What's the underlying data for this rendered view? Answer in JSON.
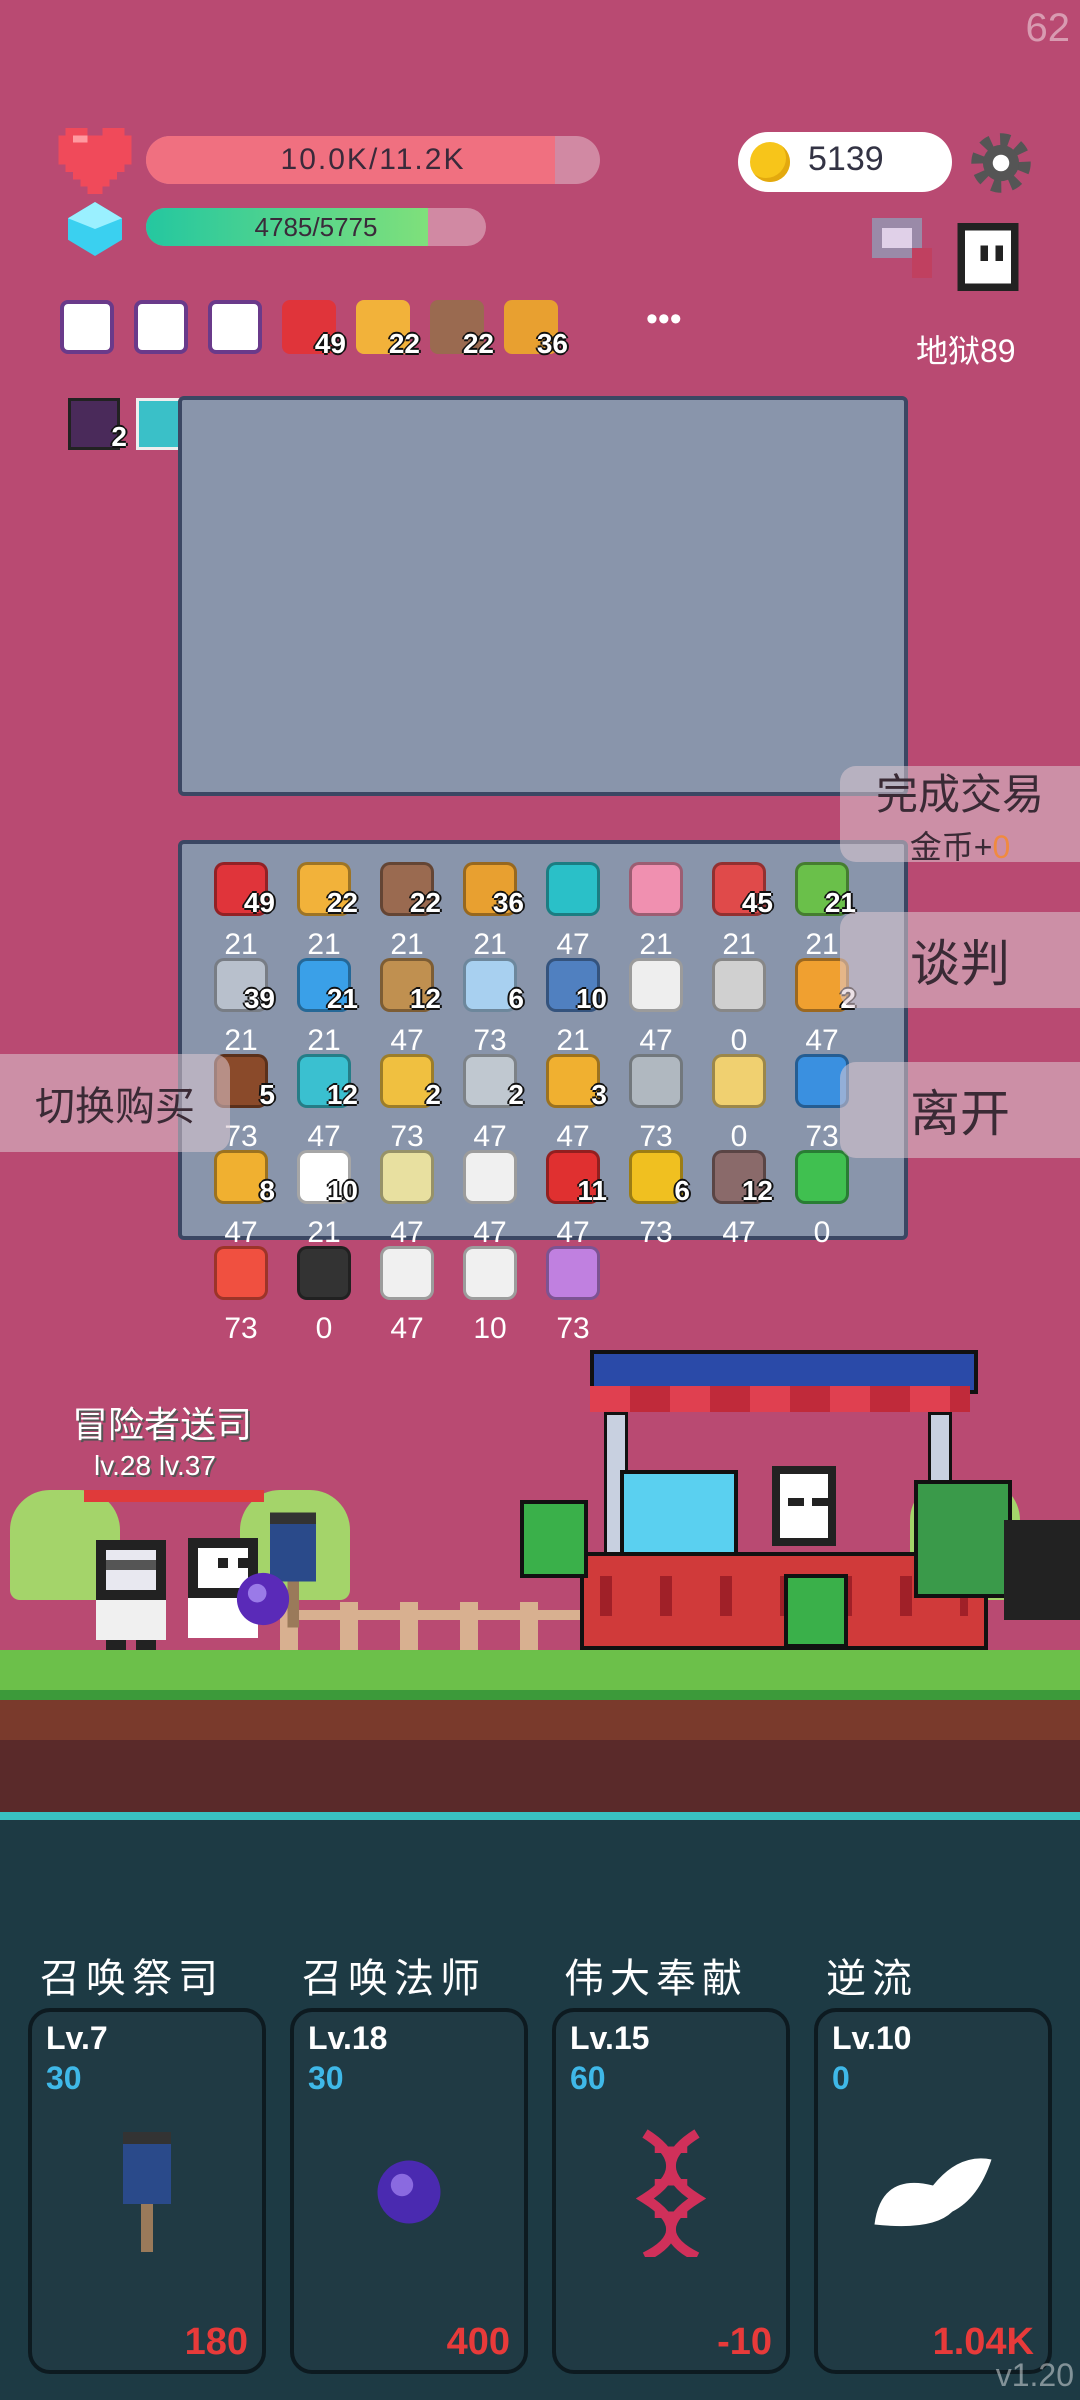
{
  "fps": "62",
  "player": {
    "hp_text": "10.0K/11.2K",
    "hp_fraction": 0.9,
    "mp_text": "4785/5775",
    "mp_fraction": 0.83,
    "gold": "5139",
    "location": "地狱89"
  },
  "inventory_bar": [
    {
      "icon": "gift-scroll-icon",
      "count": ""
    },
    {
      "icon": "gift-scroll-icon",
      "count": ""
    },
    {
      "icon": "gift-scroll-icon",
      "count": ""
    },
    {
      "icon": "apple-icon",
      "count": "49"
    },
    {
      "icon": "beer-icon",
      "count": "22"
    },
    {
      "icon": "shield-icon",
      "count": "22"
    },
    {
      "icon": "book-icon",
      "count": "36"
    }
  ],
  "more_label": "•••",
  "buffs": [
    {
      "icon": "demon-buff-icon",
      "count": "2"
    },
    {
      "icon": "lightbulb-buff-icon",
      "count": ""
    }
  ],
  "shop_items": [
    {
      "icon": "apple-icon",
      "count": "49",
      "price": "21",
      "color": "#e0343a"
    },
    {
      "icon": "beer-icon",
      "count": "22",
      "price": "21",
      "color": "#f2b23a"
    },
    {
      "icon": "shield-icon",
      "count": "22",
      "price": "21",
      "color": "#9a6a50"
    },
    {
      "icon": "book-icon",
      "count": "36",
      "price": "21",
      "color": "#e8a030"
    },
    {
      "icon": "portal-icon",
      "count": "",
      "price": "47",
      "color": "#2ac0c8"
    },
    {
      "icon": "ice-cream-icon",
      "count": "",
      "price": "21",
      "color": "#f090b0"
    },
    {
      "icon": "watermelon-icon",
      "count": "45",
      "price": "21",
      "color": "#e04a4a"
    },
    {
      "icon": "potion-icon",
      "count": "21",
      "price": "21",
      "color": "#6ac04a"
    },
    {
      "icon": "sword-icon",
      "count": "39",
      "price": "21",
      "color": "#b8c0cc"
    },
    {
      "icon": "speech-bubble-icon",
      "count": "21",
      "price": "21",
      "color": "#3aa0e8"
    },
    {
      "icon": "bow-icon",
      "count": "12",
      "price": "47",
      "color": "#c09050"
    },
    {
      "icon": "robe-icon",
      "count": "6",
      "price": "73",
      "color": "#a8d0f0"
    },
    {
      "icon": "dagger-icon",
      "count": "10",
      "price": "21",
      "color": "#5080c0"
    },
    {
      "icon": "cards-icon",
      "count": "",
      "price": "47",
      "color": "#eeeeee"
    },
    {
      "icon": "mace-icon",
      "count": "",
      "price": "0",
      "color": "#d0d0d0"
    },
    {
      "icon": "briefcase-icon",
      "count": "2",
      "price": "47",
      "color": "#f0a030"
    },
    {
      "icon": "cake-icon",
      "count": "5",
      "price": "73",
      "color": "#8a4a2a"
    },
    {
      "icon": "pen-icon",
      "count": "12",
      "price": "47",
      "color": "#3ac0d0"
    },
    {
      "icon": "meteor-icon",
      "count": "2",
      "price": "73",
      "color": "#f0c040"
    },
    {
      "icon": "axe-icon",
      "count": "2",
      "price": "47",
      "color": "#c0c8d0"
    },
    {
      "icon": "scroll-icon",
      "count": "3",
      "price": "47",
      "color": "#f0b030"
    },
    {
      "icon": "compass-icon",
      "count": "",
      "price": "73",
      "color": "#b0b8c0"
    },
    {
      "icon": "map-icon",
      "count": "",
      "price": "0",
      "color": "#f0d070"
    },
    {
      "icon": "star-card-icon",
      "count": "",
      "price": "73",
      "color": "#3a90e0"
    },
    {
      "icon": "pineapple-icon",
      "count": "8",
      "price": "47",
      "color": "#f0b030"
    },
    {
      "icon": "flower-icon",
      "count": "10",
      "price": "21",
      "color": "#ffffff"
    },
    {
      "icon": "molecule-icon",
      "count": "",
      "price": "47",
      "color": "#e8e0a0"
    },
    {
      "icon": "coconut-icon",
      "count": "",
      "price": "47",
      "color": "#f0f0f0"
    },
    {
      "icon": "red-flag-icon",
      "count": "11",
      "price": "47",
      "color": "#e03030"
    },
    {
      "icon": "fruit-icon",
      "count": "6",
      "price": "73",
      "color": "#f0c020"
    },
    {
      "icon": "tombstone-icon",
      "count": "12",
      "price": "47",
      "color": "#8a6a6a"
    },
    {
      "icon": "green-card-icon",
      "count": "",
      "price": "0",
      "color": "#40c050"
    },
    {
      "icon": "heat-icon",
      "count": "",
      "price": "73",
      "color": "#f05040"
    },
    {
      "icon": "bat-icon",
      "count": "",
      "price": "0",
      "color": "#333333"
    },
    {
      "icon": "envelope-icon",
      "count": "",
      "price": "47",
      "color": "#f0f0f0"
    },
    {
      "icon": "dice-icon",
      "count": "",
      "price": "10",
      "color": "#f0f0f0"
    },
    {
      "icon": "flower-pot-icon",
      "count": "",
      "price": "73",
      "color": "#c080e0"
    }
  ],
  "trade": {
    "complete_label": "完成交易",
    "gold_reward_prefix": "金币+",
    "gold_reward_value": "0",
    "negotiate_label": "谈判",
    "leave_label": "离开",
    "switch_buy_label": "切换购买"
  },
  "scene": {
    "overhead_name": "冒险者送司",
    "overhead_level": "lv.28 lv.37"
  },
  "skills": [
    {
      "name": "召唤祭司",
      "level": "Lv.7",
      "cost": "30",
      "value": "180",
      "icon": "banner-icon"
    },
    {
      "name": "召唤法师",
      "level": "Lv.18",
      "cost": "30",
      "value": "400",
      "icon": "purple-orb-icon"
    },
    {
      "name": "伟大奉献",
      "level": "Lv.15",
      "cost": "60",
      "value": "-10",
      "icon": "dna-icon"
    },
    {
      "name": "逆流",
      "level": "Lv.10",
      "cost": "0",
      "value": "1.04K",
      "icon": "wing-icon"
    }
  ],
  "version": "v1.20"
}
